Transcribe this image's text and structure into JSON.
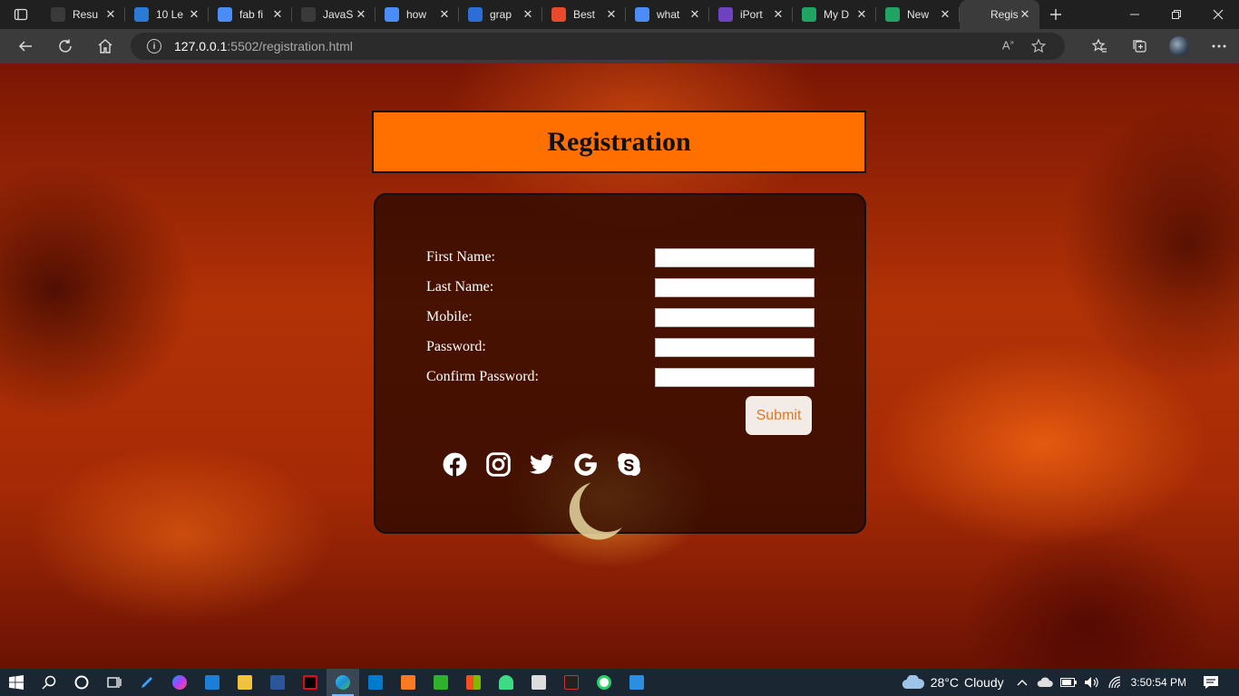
{
  "browser": {
    "tabs": [
      {
        "title": "Resu",
        "favicon": "globe-icon",
        "color": "#3a3a3a"
      },
      {
        "title": "10 Le",
        "favicon": "windows-icon",
        "color": "#2b7bd6"
      },
      {
        "title": "fab fi",
        "favicon": "search-icon",
        "color": "#4a8df6"
      },
      {
        "title": "JavaS",
        "favicon": "flag-icon",
        "color": "#3a3a3a"
      },
      {
        "title": "how",
        "favicon": "search-icon",
        "color": "#4a8df6"
      },
      {
        "title": "grap",
        "favicon": "bird-icon",
        "color": "#2b6fd6"
      },
      {
        "title": "Best",
        "favicon": "g-icon",
        "color": "#e84a2b"
      },
      {
        "title": "what",
        "favicon": "search-icon",
        "color": "#4a8df6"
      },
      {
        "title": "iPort",
        "favicon": "bootstrap-icon",
        "color": "#6f42c1"
      },
      {
        "title": "My D",
        "favicon": "drive-icon",
        "color": "#1fa463"
      },
      {
        "title": "New",
        "favicon": "drive-icon",
        "color": "#1fa463"
      },
      {
        "title": "Regis",
        "favicon": "page-icon",
        "color": "#3b3b3b",
        "active": true
      }
    ],
    "address": {
      "host": "127.0.0.1",
      "path": ":5502/registration.html"
    }
  },
  "page": {
    "title": "Registration",
    "fields": [
      {
        "label": "First Name:",
        "value": ""
      },
      {
        "label": "Last Name:",
        "value": ""
      },
      {
        "label": "Mobile:",
        "value": ""
      },
      {
        "label": "Password:",
        "value": ""
      },
      {
        "label": "Confirm Password:",
        "value": ""
      }
    ],
    "submit_label": "Submit",
    "socials": [
      "facebook-icon",
      "instagram-icon",
      "twitter-icon",
      "google-icon",
      "skype-icon"
    ],
    "colors": {
      "title_bg": "#ff7000",
      "submit_text": "#e8761e"
    }
  },
  "taskbar": {
    "weather": {
      "temp": "28°C",
      "condition": "Cloudy"
    },
    "time": "3:50:54 PM"
  }
}
